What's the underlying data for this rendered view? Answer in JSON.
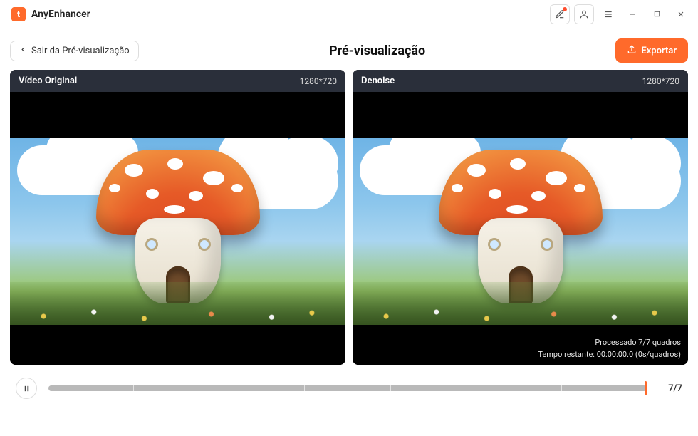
{
  "app": {
    "name": "AnyEnhancer"
  },
  "toolbar": {
    "back_label": "Sair da Pré-visualização",
    "title": "Pré-visualização",
    "export_label": "Exportar"
  },
  "panels": {
    "left": {
      "title": "Vídeo Original",
      "resolution": "1280*720"
    },
    "right": {
      "title": "Denoise",
      "resolution": "1280*720",
      "status_processed": "Processado 7/7 quadros",
      "status_remaining": "Tempo restante: 00:00:00.0 (0s/quadros)"
    }
  },
  "timeline": {
    "counter": "7/7",
    "total_segments": 7
  }
}
